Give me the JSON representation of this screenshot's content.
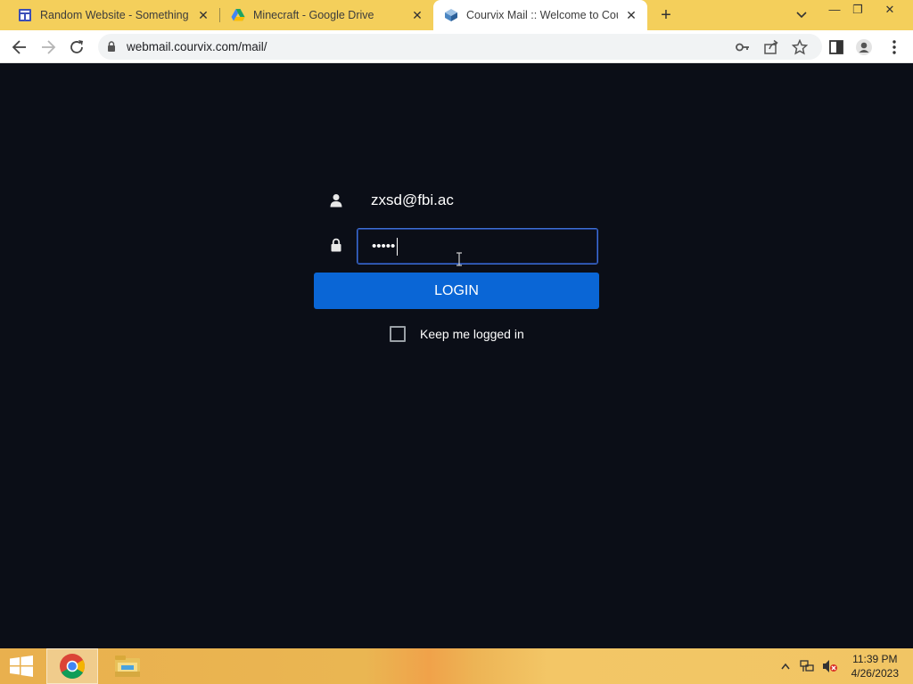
{
  "browser": {
    "tabs": [
      {
        "title": "Random Website - Something",
        "favicon": "site-icon"
      },
      {
        "title": "Minecraft - Google Drive",
        "favicon": "google-drive-icon"
      },
      {
        "title": "Courvix Mail :: Welcome to Courvix Mail",
        "favicon": "courvix-icon"
      }
    ],
    "url": "webmail.courvix.com/mail/"
  },
  "login": {
    "username": "zxsd@fbi.ac",
    "password_mask": "•••••",
    "login_label": "LOGIN",
    "remember_label": "Keep me logged in",
    "remember_checked": false,
    "button_color": "#0a66d6"
  },
  "taskbar": {
    "time": "11:39 PM",
    "date": "4/26/2023",
    "apps": [
      "chrome-icon",
      "file-explorer-icon"
    ]
  }
}
